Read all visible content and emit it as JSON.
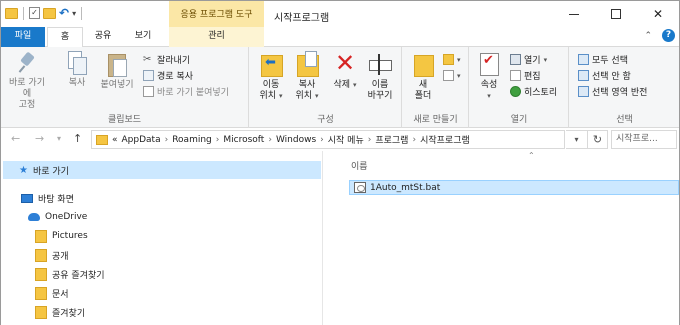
{
  "titlebar": {
    "context_tab_title": "응용 프로그램 도구",
    "window_title": "시작프로그램"
  },
  "tabs": {
    "file": "파일",
    "home": "홈",
    "share": "공유",
    "view": "보기",
    "manage": "관리"
  },
  "ribbon": {
    "clipboard": {
      "pin_label": "바로 가기에\n고정",
      "copy": "복사",
      "paste": "붙여넣기",
      "cut": "잘라내기",
      "copy_path": "경로 복사",
      "paste_shortcut": "바로 가기 붙여넣기",
      "group": "클립보드"
    },
    "organize": {
      "move_to": "이동\n위치",
      "copy_to": "복사\n위치",
      "delete": "삭제",
      "rename": "이름\n바꾸기",
      "group": "구성"
    },
    "new": {
      "new_folder": "새\n폴더",
      "group": "새로 만들기"
    },
    "open": {
      "properties": "속성",
      "open": "열기",
      "edit": "편집",
      "history": "히스토리",
      "group": "열기"
    },
    "select": {
      "select_all": "모두 선택",
      "select_none": "선택 안 함",
      "invert": "선택 영역 반전",
      "group": "선택"
    }
  },
  "address": {
    "prefix": "«",
    "crumbs": [
      "AppData",
      "Roaming",
      "Microsoft",
      "Windows",
      "시작 메뉴",
      "프로그램",
      "시작프로그램"
    ],
    "search_placeholder": "시작프로..."
  },
  "navpane": {
    "quick_access": "바로 가기",
    "desktop": "바탕 화면",
    "onedrive": "OneDrive",
    "folders": [
      "Pictures",
      "공개",
      "공유 즐겨찾기",
      "문서",
      "즐겨찾기"
    ]
  },
  "content": {
    "column_name": "이름",
    "files": [
      "1Auto_mtSt.bat"
    ]
  }
}
